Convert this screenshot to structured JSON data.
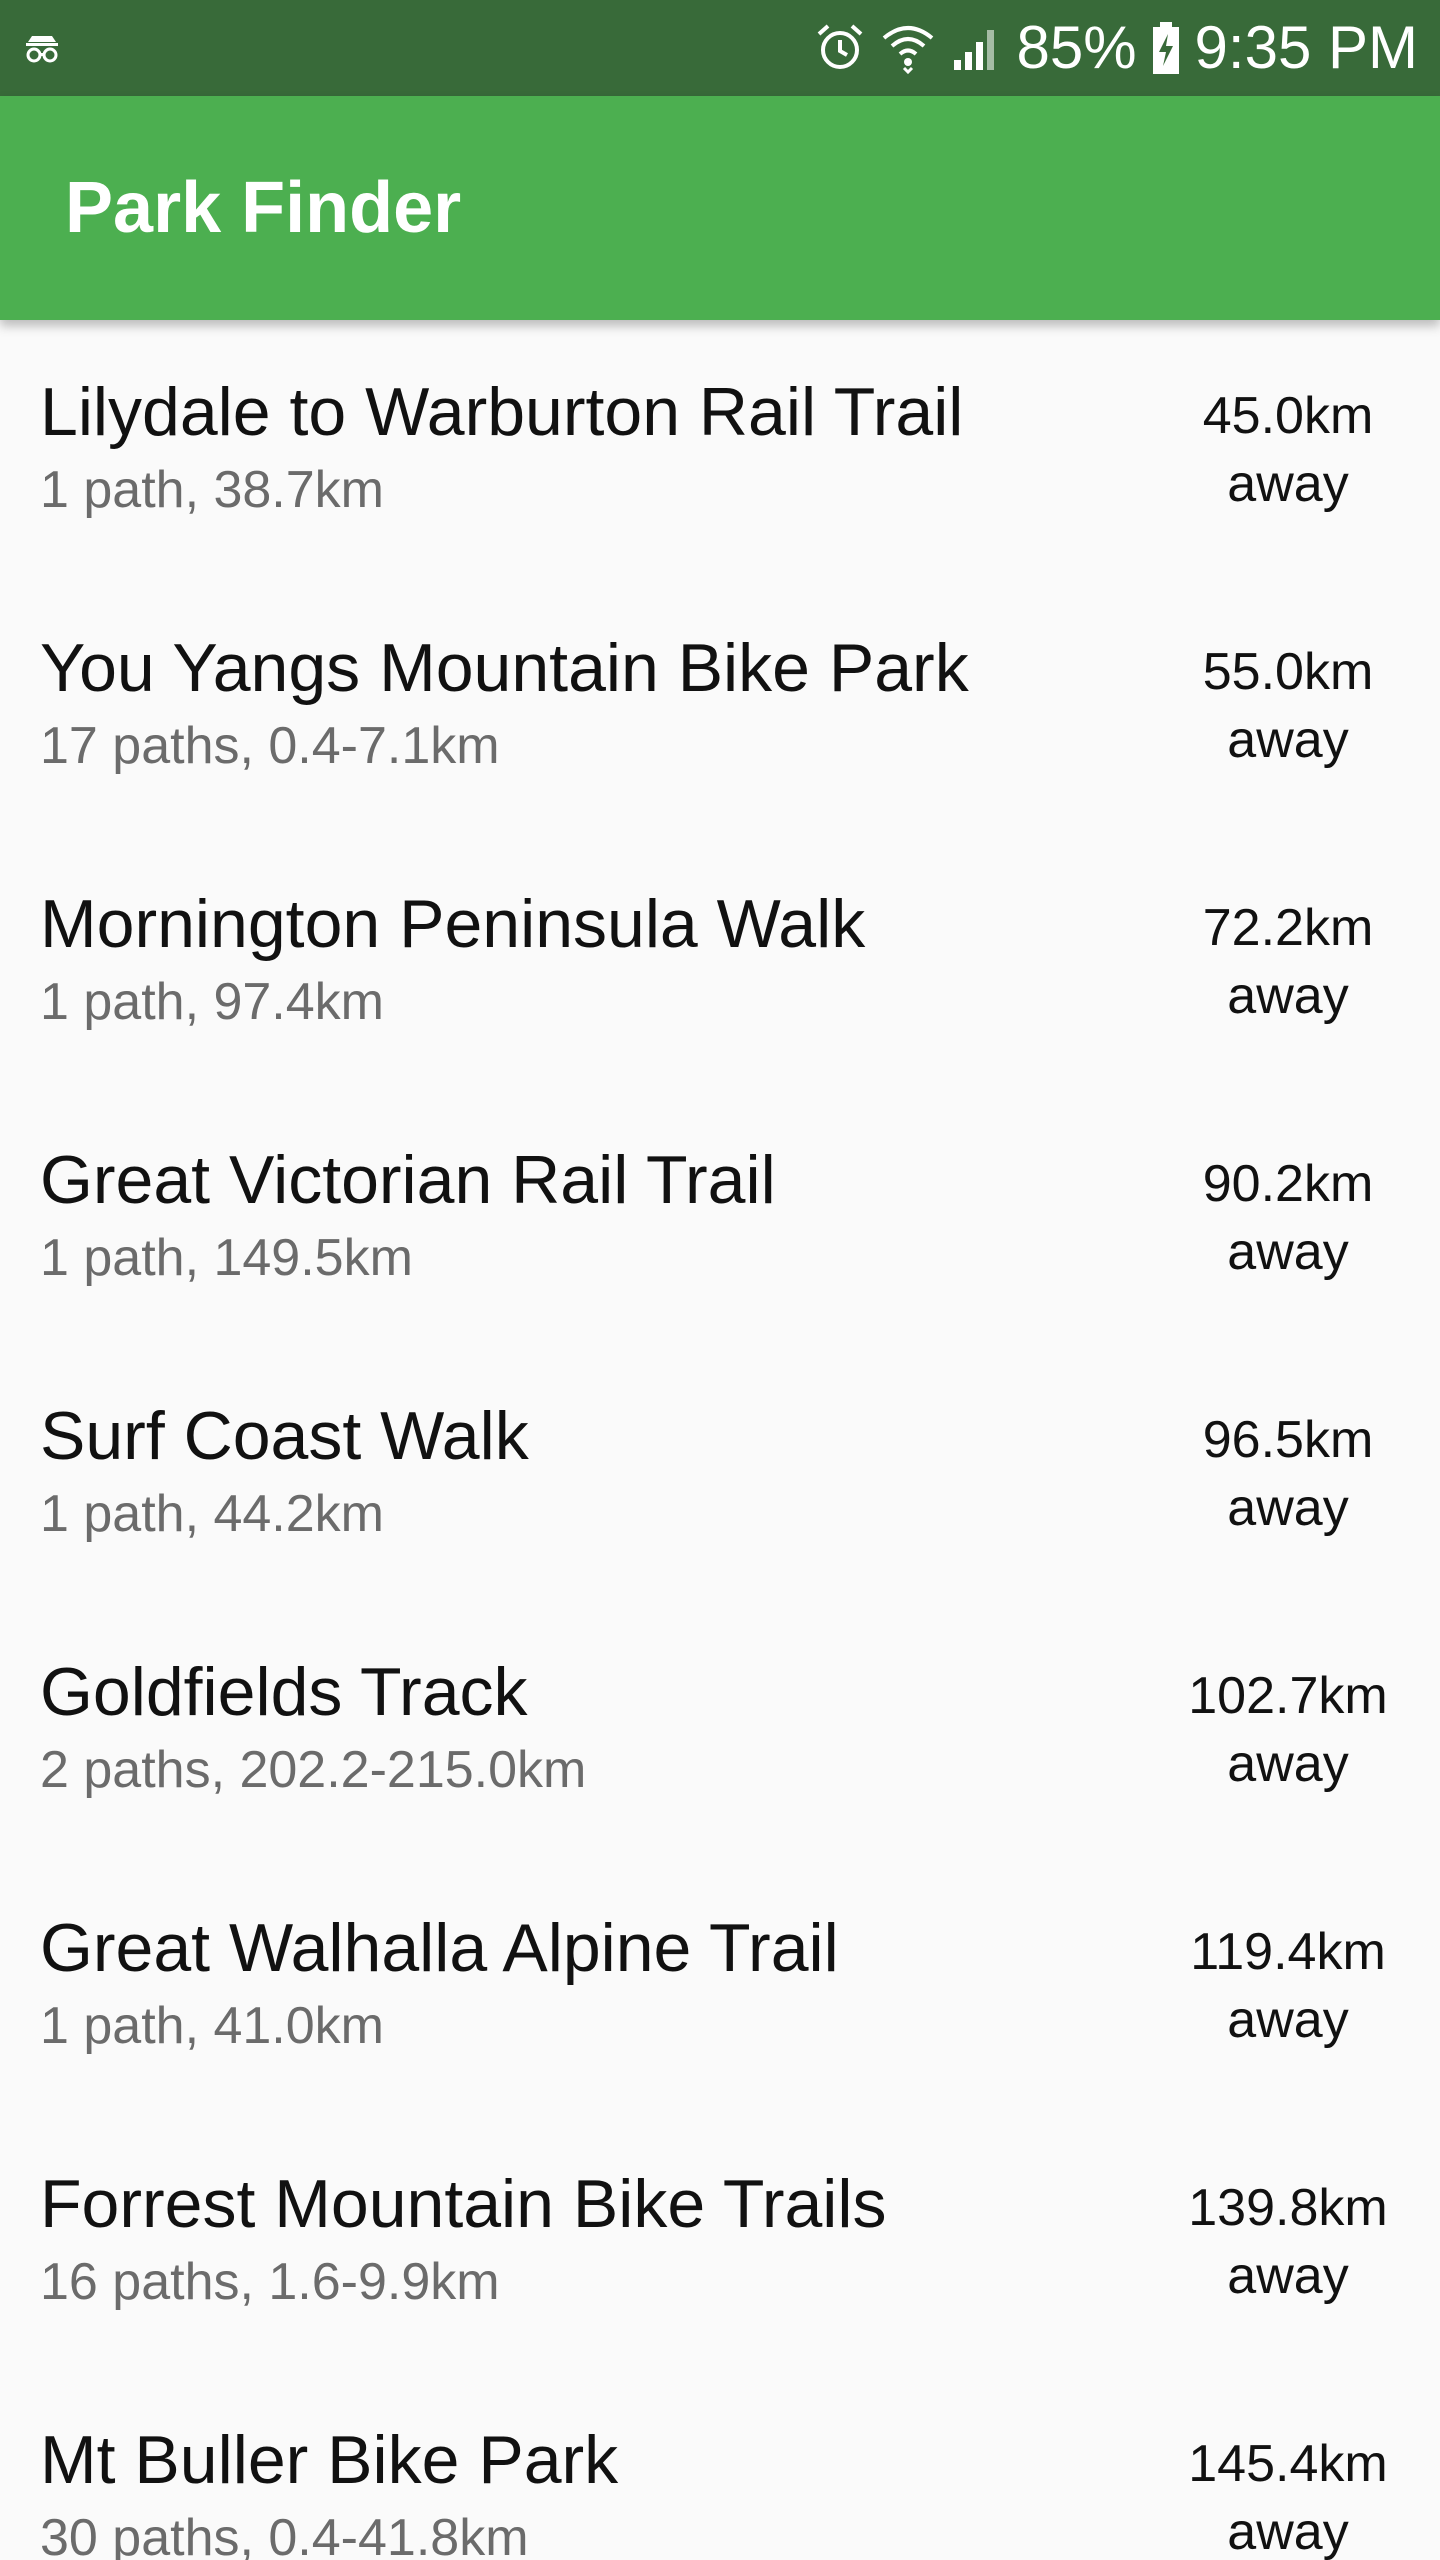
{
  "status_bar": {
    "battery": "85%",
    "time": "9:35 PM",
    "icons": [
      "incognito-icon",
      "alarm-icon",
      "wifi-icon",
      "signal-icon",
      "battery-charging-icon"
    ]
  },
  "app_bar": {
    "title": "Park Finder",
    "color": "#4caf50"
  },
  "parks": [
    {
      "name": "Lilydale to Warburton Rail Trail",
      "details": "1 path, 38.7km",
      "distance": "45.0km",
      "distance_suffix": "away"
    },
    {
      "name": "You Yangs Mountain Bike Park",
      "details": "17 paths, 0.4-7.1km",
      "distance": "55.0km",
      "distance_suffix": "away"
    },
    {
      "name": "Mornington Peninsula Walk",
      "details": "1 path, 97.4km",
      "distance": "72.2km",
      "distance_suffix": "away"
    },
    {
      "name": "Great Victorian Rail Trail",
      "details": "1 path, 149.5km",
      "distance": "90.2km",
      "distance_suffix": "away"
    },
    {
      "name": "Surf Coast Walk",
      "details": "1 path, 44.2km",
      "distance": "96.5km",
      "distance_suffix": "away"
    },
    {
      "name": "Goldfields Track",
      "details": "2 paths, 202.2-215.0km",
      "distance": "102.7km",
      "distance_suffix": "away"
    },
    {
      "name": "Great Walhalla Alpine Trail",
      "details": "1 path, 41.0km",
      "distance": "119.4km",
      "distance_suffix": "away"
    },
    {
      "name": "Forrest Mountain Bike Trails",
      "details": "16 paths, 1.6-9.9km",
      "distance": "139.8km",
      "distance_suffix": "away"
    },
    {
      "name": "Mt Buller Bike Park",
      "details": "30 paths, 0.4-41.8km",
      "distance": "145.4km",
      "distance_suffix": "away"
    }
  ]
}
